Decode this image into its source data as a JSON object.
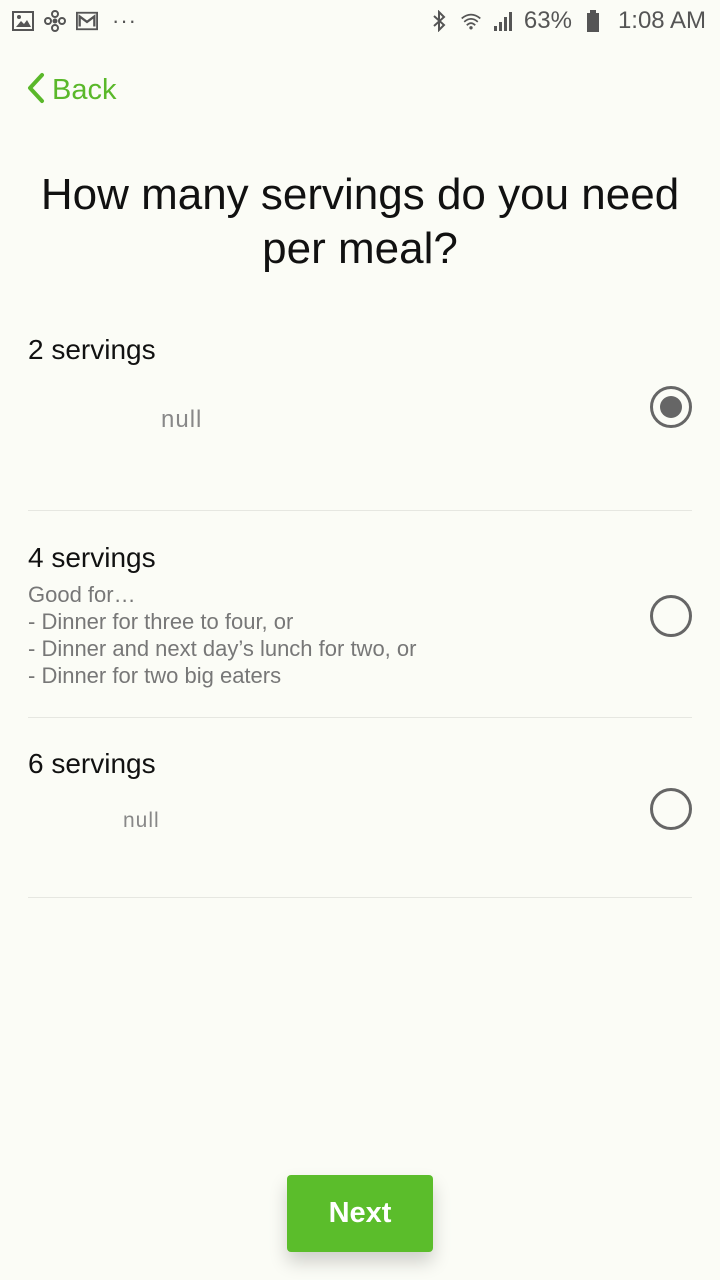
{
  "status_bar": {
    "notification_icons": [
      "gallery-icon",
      "pinwheel-icon",
      "gmail-icon"
    ],
    "more": "···",
    "battery": "63%",
    "time": "1:08 AM"
  },
  "nav": {
    "back_label": "Back"
  },
  "title": "How many servings do you need per meal?",
  "options": [
    {
      "title": "2 servings",
      "description": "null",
      "selected": true
    },
    {
      "title": "4 servings",
      "description_lines": [
        "Good for…",
        "- Dinner for three to four, or",
        "- Dinner and next day’s lunch for two, or",
        "- Dinner for two big eaters"
      ],
      "selected": false
    },
    {
      "title": "6 servings",
      "description": "null",
      "selected": false
    }
  ],
  "next_button": {
    "label": "Next"
  },
  "colors": {
    "accent": "#5bbd2b",
    "background": "#fbfcf6"
  }
}
